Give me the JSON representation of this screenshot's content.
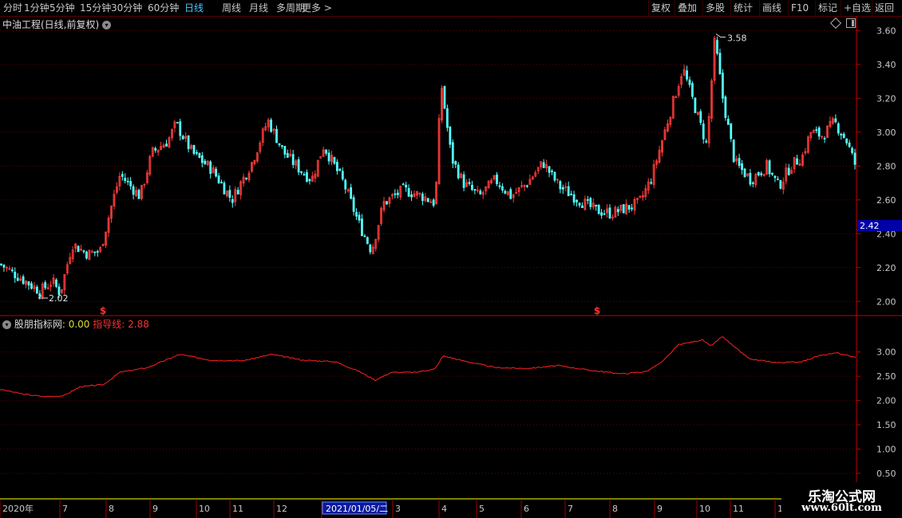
{
  "toolbar": {
    "left": [
      "分时",
      "1分钟",
      "5分钟",
      "15分钟",
      "30分钟",
      "60分钟",
      "日线",
      "周线",
      "月线",
      "多周期",
      "更多 >"
    ],
    "active": "日线",
    "right": [
      "复权",
      "叠加",
      "多股",
      "统计",
      "画线",
      "F10",
      "标记",
      "+自选",
      "返回"
    ]
  },
  "main_title": "中油工程(日线,前复权)",
  "indicator": {
    "name": "股朋指标网",
    "name_value": ": 0.00",
    "line_name": "指导线",
    "line_value": ": 2.88"
  },
  "price_badge": "2.42",
  "logo": {
    "title": "乐淘公式网",
    "url": "www.60lt.com"
  },
  "colors": {
    "up": "#ff3c3c",
    "down": "#54ffff",
    "guide": "#ff2020",
    "axis": "#c00000",
    "highlight": "#0a1aa0"
  },
  "chart_data": [
    {
      "type": "candlestick",
      "title": "中油工程(日线,前复权)",
      "y_ticks": [
        "2.00",
        "2.20",
        "2.40",
        "2.60",
        "2.80",
        "3.00",
        "3.20",
        "3.40",
        "3.60"
      ],
      "ylim": [
        1.94,
        3.63
      ],
      "annotations": [
        {
          "label": "3.58",
          "kind": "high",
          "value": 3.58
        },
        {
          "label": "2.02",
          "kind": "low",
          "value": 2.02
        }
      ],
      "dividend_markers": [
        "$",
        "$"
      ],
      "close_path": {
        "knots": [
          [
            0,
            2.22
          ],
          [
            25,
            2.14
          ],
          [
            50,
            2.06
          ],
          [
            65,
            2.12
          ],
          [
            75,
            2.05
          ],
          [
            90,
            2.34
          ],
          [
            110,
            2.28
          ],
          [
            125,
            2.3
          ],
          [
            140,
            2.58
          ],
          [
            150,
            2.75
          ],
          [
            175,
            2.62
          ],
          [
            190,
            2.88
          ],
          [
            210,
            2.95
          ],
          [
            220,
            3.05
          ],
          [
            240,
            2.88
          ],
          [
            265,
            2.78
          ],
          [
            290,
            2.6
          ],
          [
            315,
            2.82
          ],
          [
            335,
            3.07
          ],
          [
            355,
            2.88
          ],
          [
            375,
            2.78
          ],
          [
            390,
            2.72
          ],
          [
            405,
            2.92
          ],
          [
            430,
            2.7
          ],
          [
            450,
            2.45
          ],
          [
            465,
            2.3
          ],
          [
            480,
            2.58
          ],
          [
            505,
            2.66
          ],
          [
            530,
            2.62
          ],
          [
            545,
            2.58
          ],
          [
            552,
            3.3
          ],
          [
            565,
            2.85
          ],
          [
            580,
            2.7
          ],
          [
            600,
            2.62
          ],
          [
            620,
            2.72
          ],
          [
            640,
            2.62
          ],
          [
            660,
            2.7
          ],
          [
            680,
            2.82
          ],
          [
            700,
            2.68
          ],
          [
            725,
            2.6
          ],
          [
            745,
            2.54
          ],
          [
            765,
            2.52
          ],
          [
            800,
            2.58
          ],
          [
            815,
            2.72
          ],
          [
            835,
            3.05
          ],
          [
            855,
            3.38
          ],
          [
            870,
            3.15
          ],
          [
            885,
            2.92
          ],
          [
            895,
            3.55
          ],
          [
            905,
            3.2
          ],
          [
            920,
            2.82
          ],
          [
            940,
            2.72
          ],
          [
            960,
            2.8
          ],
          [
            975,
            2.68
          ],
          [
            990,
            2.8
          ],
          [
            1005,
            2.86
          ],
          [
            1015,
            3.0
          ],
          [
            1030,
            2.98
          ],
          [
            1045,
            3.06
          ],
          [
            1060,
            2.95
          ],
          [
            1073,
            2.78
          ]
        ],
        "volatility": 0.05
      },
      "x_ticks": [
        "2020年",
        "7",
        "8",
        "9",
        "10",
        "11",
        "12",
        "2021/01/05/二",
        "3",
        "4",
        "5",
        "6",
        "7",
        "8",
        "9",
        "10",
        "11",
        "1"
      ]
    },
    {
      "type": "line",
      "series": [
        {
          "name": "指导线",
          "knots": [
            [
              0,
              2.23
            ],
            [
              30,
              2.13
            ],
            [
              55,
              2.08
            ],
            [
              80,
              2.1
            ],
            [
              100,
              2.28
            ],
            [
              130,
              2.33
            ],
            [
              150,
              2.58
            ],
            [
              185,
              2.68
            ],
            [
              225,
              2.95
            ],
            [
              265,
              2.83
            ],
            [
              305,
              2.82
            ],
            [
              340,
              2.95
            ],
            [
              380,
              2.83
            ],
            [
              420,
              2.8
            ],
            [
              450,
              2.6
            ],
            [
              470,
              2.42
            ],
            [
              490,
              2.58
            ],
            [
              520,
              2.58
            ],
            [
              545,
              2.65
            ],
            [
              555,
              2.92
            ],
            [
              580,
              2.82
            ],
            [
              620,
              2.68
            ],
            [
              660,
              2.66
            ],
            [
              700,
              2.72
            ],
            [
              740,
              2.62
            ],
            [
              780,
              2.55
            ],
            [
              810,
              2.6
            ],
            [
              830,
              2.8
            ],
            [
              850,
              3.15
            ],
            [
              880,
              3.25
            ],
            [
              890,
              3.12
            ],
            [
              905,
              3.32
            ],
            [
              920,
              3.1
            ],
            [
              940,
              2.85
            ],
            [
              975,
              2.78
            ],
            [
              1005,
              2.8
            ],
            [
              1025,
              2.92
            ],
            [
              1050,
              2.98
            ],
            [
              1073,
              2.88
            ]
          ]
        }
      ],
      "y_ticks": [
        "0.50",
        "1.00",
        "1.50",
        "2.00",
        "2.50",
        "3.00"
      ],
      "ylim": [
        0.45,
        3.52
      ]
    }
  ]
}
